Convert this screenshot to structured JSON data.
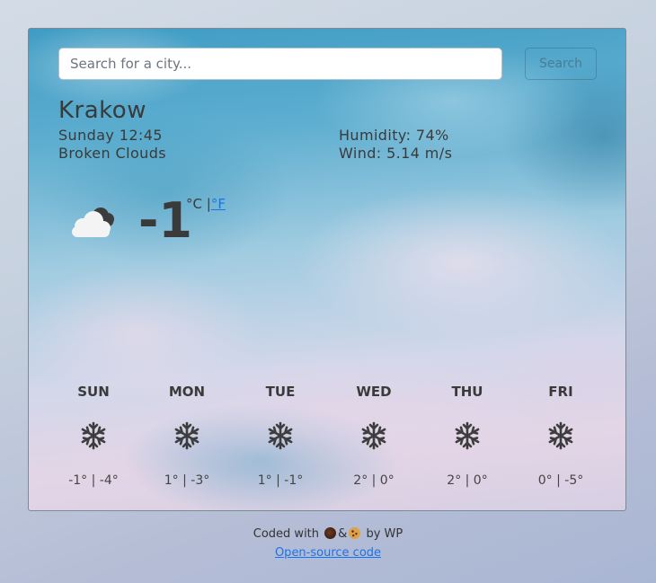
{
  "search": {
    "placeholder": "Search for a city...",
    "value": "",
    "button_label": "Search"
  },
  "current": {
    "city": "Krakow",
    "datetime": "Sunday 12:45",
    "condition": "Broken Clouds",
    "humidity": "Humidity: 74%",
    "wind": "Wind: 5.14 m/s",
    "temperature": "-1",
    "unit_celsius": "°C",
    "unit_separator": " |",
    "unit_fahrenheit": "°F",
    "icon": "broken-clouds-icon"
  },
  "forecast": [
    {
      "day": "SUN",
      "temps": "-1° | -4°",
      "icon": "snowflake-icon"
    },
    {
      "day": "MON",
      "temps": "1° | -3°",
      "icon": "snowflake-icon"
    },
    {
      "day": "TUE",
      "temps": "1° | -1°",
      "icon": "snowflake-icon"
    },
    {
      "day": "WED",
      "temps": "2° | 0°",
      "icon": "snowflake-icon"
    },
    {
      "day": "THU",
      "temps": "2° | 0°",
      "icon": "snowflake-icon"
    },
    {
      "day": "FRI",
      "temps": "0° | -5°",
      "icon": "snowflake-icon"
    }
  ],
  "footer": {
    "coded_with": "Coded with",
    "ampersand": "&",
    "by": "by WP",
    "source_link": "Open-source code"
  },
  "colors": {
    "text": "#3a3a3a",
    "link": "#1a73e8",
    "sky_top": "#3f9cc4",
    "sky_bottom": "#e3d5e6"
  }
}
